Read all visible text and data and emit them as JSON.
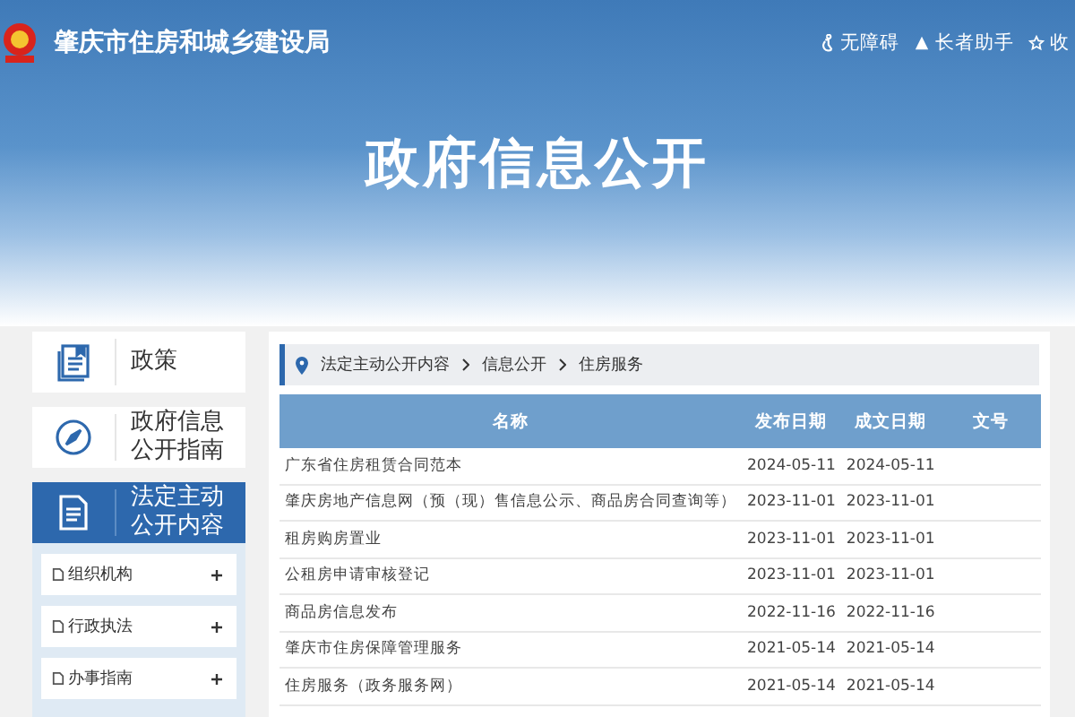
{
  "header": {
    "site_title": "肇庆市住房和城乡建设局",
    "links": [
      {
        "kind": "accessibility",
        "label": "无障碍"
      },
      {
        "kind": "elder",
        "label": "长者助手"
      },
      {
        "kind": "favorite",
        "label": "收"
      }
    ],
    "banner_title": "政府信息公开"
  },
  "sidebar": {
    "items": [
      {
        "kind": "book",
        "label": "政策",
        "selected": false
      },
      {
        "kind": "compass",
        "label": "政府信息公开指南",
        "selected": false
      },
      {
        "kind": "document",
        "label": "法定主动公开内容",
        "selected": true
      }
    ],
    "subitems": [
      {
        "label": "组织机构",
        "expanded": false
      },
      {
        "label": "行政执法",
        "expanded": false
      },
      {
        "label": "办事指南",
        "expanded": false
      }
    ]
  },
  "breadcrumb": [
    "法定主动公开内容",
    "信息公开",
    "住房服务"
  ],
  "table": {
    "columns": [
      "名称",
      "发布日期",
      "成文日期",
      "文号"
    ],
    "rows": [
      [
        "广东省住房租赁合同范本",
        "2024-05-11",
        "2024-05-11"
      ],
      [
        "肇庆房地产信息网（预（现）售信息公示、商品房合同查询等）",
        "2023-11-01",
        "2023-11-01"
      ],
      [
        "租房购房置业",
        "2023-11-01",
        "2023-11-01"
      ],
      [
        "公租房申请审核登记",
        "2023-11-01",
        "2023-11-01"
      ],
      [
        "商品房信息发布",
        "2022-11-16",
        "2022-11-16"
      ],
      [
        "肇庆市住房保障管理服务",
        "2021-05-14",
        "2021-05-14"
      ],
      [
        "住房服务（政务服务网）",
        "2021-05-14",
        "2021-05-14"
      ]
    ]
  }
}
